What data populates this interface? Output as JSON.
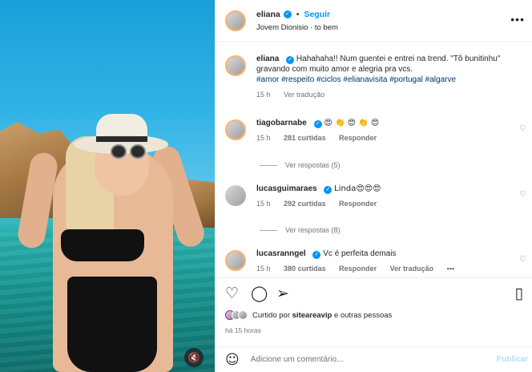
{
  "post_header": {
    "username": "eliana",
    "follow_label": "Seguir",
    "separator": "•",
    "audio_line": "Jovem Dionisio · to bem",
    "more_icon": "more-horizontal-icon"
  },
  "caption": {
    "username": "eliana",
    "text": "Hahahaha!! Num guentei e entrei na trend. \"Tô bunitinhu\" gravando com muito amor e alegria pra vcs.",
    "hashtags": "#amor #respeito #ciclos #elianavisita #portugal #algarve",
    "time": "15 h",
    "translate_label": "Ver tradução"
  },
  "comments": [
    {
      "username": "tiagobarnabe",
      "text": "😍 👏 😍 👏 😍",
      "time": "15 h",
      "likes": "281 curtidas",
      "reply_label": "Responder",
      "view_replies": "Ver respostas (5)"
    },
    {
      "username": "lucasguimaraes",
      "text": "Linda😍😍😍",
      "time": "15 h",
      "likes": "292 curtidas",
      "reply_label": "Responder",
      "view_replies": "Ver respostas (8)"
    },
    {
      "username": "lucasranngel",
      "text": "Vc é perfeita demais",
      "time": "15 h",
      "likes": "380 curtidas",
      "reply_label": "Responder",
      "translate_label": "Ver tradução",
      "more": "•••"
    }
  ],
  "actions": {
    "like_icon": "heart-icon",
    "comment_icon": "comment-icon",
    "share_icon": "share-icon",
    "save_icon": "bookmark-icon",
    "liked_by_prefix": "Curtido por",
    "liked_by_user": "siteareavip",
    "liked_by_suffix": "e outras pessoas",
    "time_ago": "há 15 horas"
  },
  "add_comment": {
    "placeholder": "Adicione um comentário...",
    "publish_label": "Publicar",
    "emoji_icon": "smile-icon"
  },
  "media": {
    "sound_icon": "speaker-muted-icon"
  },
  "colors": {
    "accent": "#0095f6",
    "hashtag": "#00376b",
    "muted": "#737373"
  }
}
